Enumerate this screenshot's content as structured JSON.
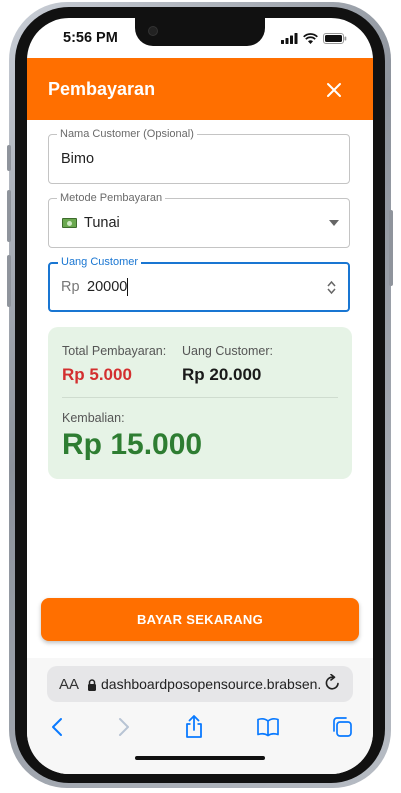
{
  "status_bar": {
    "time": "5:56 PM"
  },
  "header": {
    "title": "Pembayaran"
  },
  "form": {
    "customer": {
      "label": "Nama Customer (Opsional)",
      "value": "Bimo"
    },
    "payment_method": {
      "label": "Metode Pembayaran",
      "value": "Tunai",
      "icon": "money-icon"
    },
    "customer_money": {
      "label": "Uang Customer",
      "prefix": "Rp",
      "value": "20000"
    }
  },
  "summary": {
    "total_label": "Total Pembayaran:",
    "total_value": "Rp 5.000",
    "customer_label": "Uang Customer:",
    "customer_value": "Rp 20.000",
    "change_label": "Kembalian:",
    "change_value": "Rp 15.000"
  },
  "pay_button": {
    "label": "BAYAR SEKARANG"
  },
  "browser": {
    "aa_label": "AA",
    "url": "dashboardposopensource.brabsen.m"
  },
  "colors": {
    "accent": "#ff6f00",
    "total": "#d32f2f",
    "change": "#2e7d32",
    "card_bg": "#e6f3e6",
    "focus": "#1976d2"
  }
}
